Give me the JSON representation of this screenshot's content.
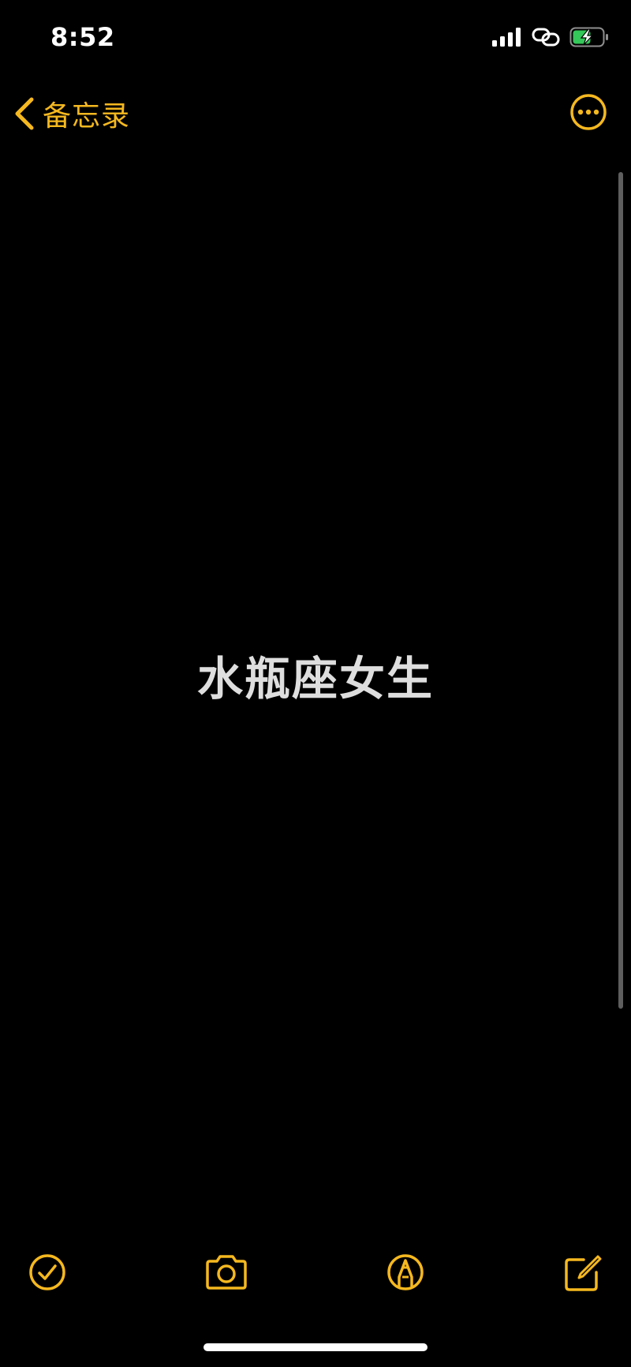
{
  "status_bar": {
    "time": "8:52",
    "icons": [
      "cellular-signal-icon",
      "link-icon",
      "battery-charging-icon"
    ]
  },
  "nav": {
    "back_label": "备忘录",
    "back_icon": "chevron-left-icon",
    "more_icon": "ellipsis-circle-icon"
  },
  "note": {
    "text": "水瓶座女生"
  },
  "toolbar": {
    "icons": [
      "checklist-icon",
      "camera-icon",
      "markup-pen-icon",
      "compose-icon"
    ]
  },
  "colors": {
    "accent": "#f5b81f",
    "background": "#000000",
    "note_text": "#dedede",
    "battery_green": "#34c759"
  }
}
